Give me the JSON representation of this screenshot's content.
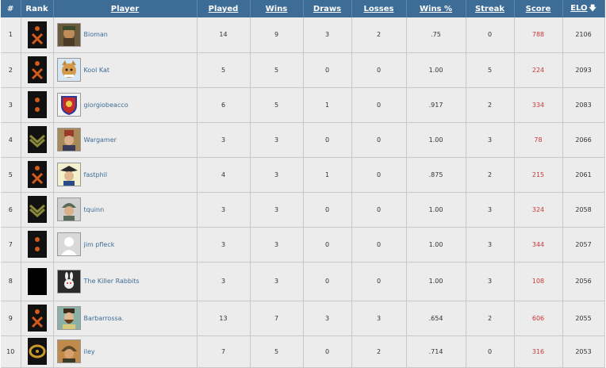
{
  "headers": {
    "num": "#",
    "rank": "Rank",
    "player": "Player",
    "played": "Played",
    "wins": "Wins",
    "draws": "Draws",
    "losses": "Losses",
    "winspct": "Wins %",
    "streak": "Streak",
    "score": "Score",
    "elo": "ELO",
    "elo_sort_icon": "🡇"
  },
  "colors": {
    "header_bg": "#3d6c96",
    "score_text": "#c9383a",
    "link_text": "#3d6c96"
  },
  "rows": [
    {
      "num": "1",
      "rank_icon": "crossed-swords-insignia-icon",
      "avatar_icon": "bearded-soldier-avatar",
      "player": "Bioman",
      "played": "14",
      "wins": "9",
      "draws": "3",
      "losses": "2",
      "winspct": ".75",
      "streak": "0",
      "score": "788",
      "elo": "2106"
    },
    {
      "num": "2",
      "rank_icon": "crossed-swords-insignia-icon",
      "avatar_icon": "cat-avatar",
      "player": "Kool Kat",
      "played": "5",
      "wins": "5",
      "draws": "0",
      "losses": "0",
      "winspct": "1.00",
      "streak": "5",
      "score": "224",
      "elo": "2093"
    },
    {
      "num": "3",
      "rank_icon": "two-dots-insignia-icon",
      "avatar_icon": "shield-crest-avatar",
      "player": "giorgiobeacco",
      "played": "6",
      "wins": "5",
      "draws": "1",
      "losses": "0",
      "winspct": ".917",
      "streak": "2",
      "score": "334",
      "elo": "2083"
    },
    {
      "num": "4",
      "rank_icon": "chevron-insignia-icon",
      "avatar_icon": "officer-kepi-avatar",
      "player": "Wargamer",
      "played": "3",
      "wins": "3",
      "draws": "0",
      "losses": "0",
      "winspct": "1.00",
      "streak": "3",
      "score": "78",
      "elo": "2066"
    },
    {
      "num": "5",
      "rank_icon": "crossed-swords-insignia-icon",
      "avatar_icon": "tricorn-hat-avatar",
      "player": "fastphil",
      "played": "4",
      "wins": "3",
      "draws": "1",
      "losses": "0",
      "winspct": ".875",
      "streak": "2",
      "score": "215",
      "elo": "2061"
    },
    {
      "num": "6",
      "rank_icon": "chevron-insignia-icon",
      "avatar_icon": "helmeted-soldier-avatar",
      "player": "tquinn",
      "played": "3",
      "wins": "3",
      "draws": "0",
      "losses": "0",
      "winspct": "1.00",
      "streak": "3",
      "score": "324",
      "elo": "2058"
    },
    {
      "num": "7",
      "rank_icon": "two-dots-insignia-icon",
      "avatar_icon": "default-person-avatar",
      "player": "jim pfleck",
      "played": "3",
      "wins": "3",
      "draws": "0",
      "losses": "0",
      "winspct": "1.00",
      "streak": "3",
      "score": "344",
      "elo": "2057"
    },
    {
      "num": "8",
      "rank_icon": "blank-insignia-icon",
      "avatar_icon": "rabbit-avatar",
      "player": "The Killer Rabbits",
      "played": "3",
      "wins": "3",
      "draws": "0",
      "losses": "0",
      "winspct": "1.00",
      "streak": "3",
      "score": "108",
      "elo": "2056"
    },
    {
      "num": "9",
      "rank_icon": "crossed-swords-insignia-icon",
      "avatar_icon": "bearded-man-avatar",
      "player": "Barbarrossa.",
      "played": "13",
      "wins": "7",
      "draws": "3",
      "losses": "3",
      "winspct": ".654",
      "streak": "2",
      "score": "606",
      "elo": "2055"
    },
    {
      "num": "10",
      "rank_icon": "gold-laurel-insignia-icon",
      "avatar_icon": "helmet-soldier-avatar",
      "player": "iley",
      "played": "7",
      "wins": "5",
      "draws": "0",
      "losses": "2",
      "winspct": ".714",
      "streak": "0",
      "score": "316",
      "elo": "2053"
    }
  ]
}
